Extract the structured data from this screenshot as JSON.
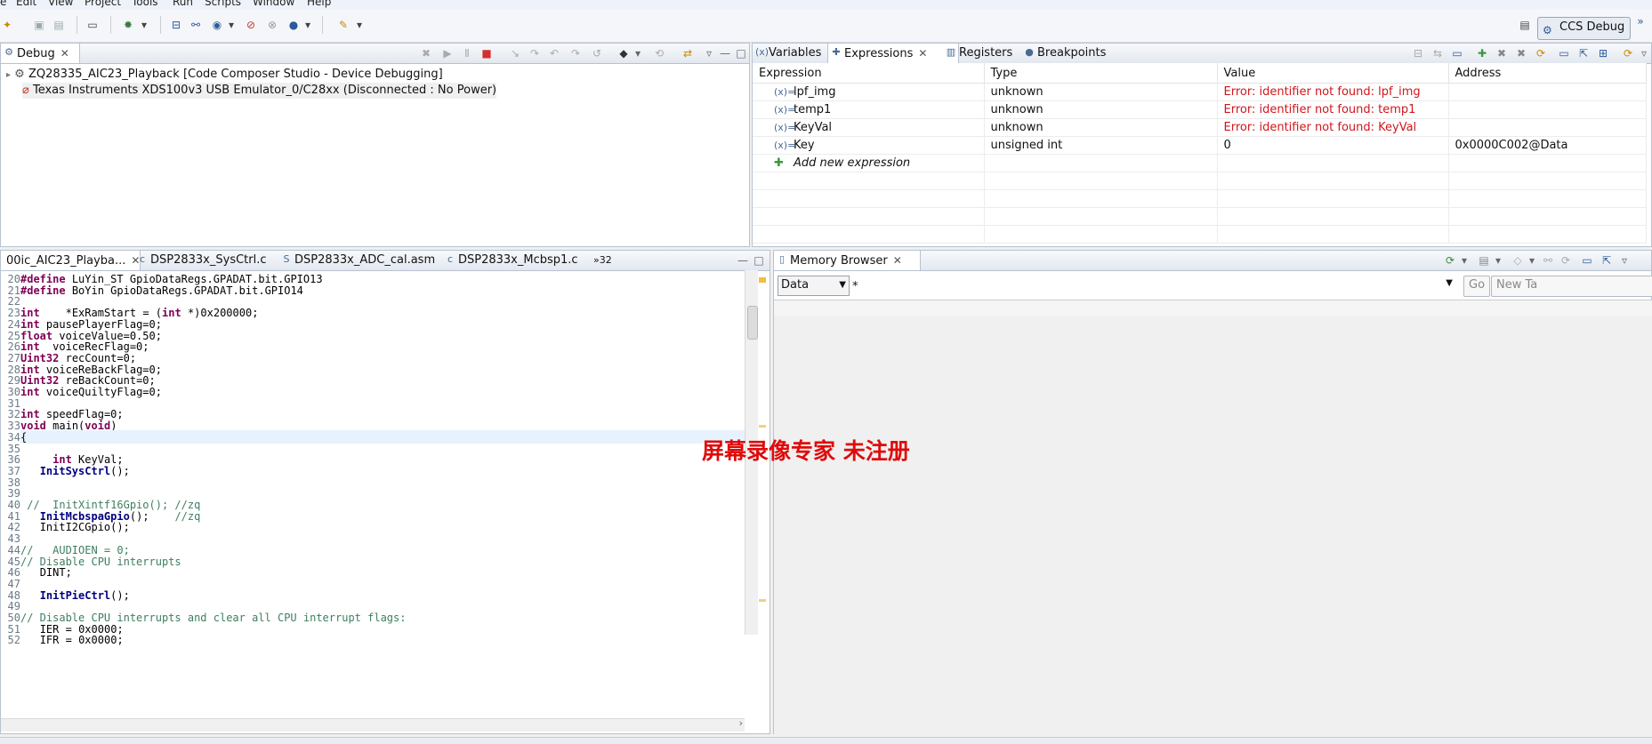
{
  "menu": [
    "e",
    "Edit",
    "View",
    "Project",
    "Tools",
    "Run",
    "Scripts",
    "Window",
    "Help"
  ],
  "perspective": {
    "label": "CCS Debug"
  },
  "debug_view": {
    "tab": "Debug",
    "rows": [
      "ZQ28335_AIC23_Playback [Code Composer Studio - Device Debugging]",
      "Texas Instruments XDS100v3 USB Emulator_0/C28xx (Disconnected : No Power)"
    ]
  },
  "expressions_view": {
    "tabs": [
      "Variables",
      "Expressions",
      "Registers",
      "Breakpoints"
    ],
    "columns": [
      "Expression",
      "Type",
      "Value",
      "Address"
    ],
    "rows": [
      {
        "icon": "(x)=",
        "name": "lpf_img",
        "type": "unknown",
        "value": "Error: identifier not found: lpf_img",
        "address": ""
      },
      {
        "icon": "(x)=",
        "name": "temp1",
        "type": "unknown",
        "value": "Error: identifier not found: temp1",
        "address": ""
      },
      {
        "icon": "(x)=",
        "name": "KeyVal",
        "type": "unknown",
        "value": "Error: identifier not found: KeyVal",
        "address": ""
      },
      {
        "icon": "(x)=",
        "name": "Key",
        "type": "unsigned int",
        "value": "0",
        "address": "0x0000C002@Data"
      }
    ],
    "add_new": "Add new expression"
  },
  "editor": {
    "tabs": [
      "00ic_AIC23_Playba...",
      "DSP2833x_SysCtrl.c",
      "DSP2833x_ADC_cal.asm",
      "DSP2833x_Mcbsp1.c",
      "32"
    ],
    "lines": [
      {
        "n": "20",
        "t": "#define LuYin_ST GpioDataRegs.GPADAT.bit.GPIO13"
      },
      {
        "n": "21",
        "t": "#define BoYin GpioDataRegs.GPADAT.bit.GPIO14"
      },
      {
        "n": "22",
        "t": ""
      },
      {
        "n": "23",
        "t": "int    *ExRamStart = (int *)0x200000;"
      },
      {
        "n": "24",
        "t": "int pausePlayerFlag=0;"
      },
      {
        "n": "25",
        "t": "float voiceValue=0.50;"
      },
      {
        "n": "26",
        "t": "int  voiceRecFlag=0;"
      },
      {
        "n": "27",
        "t": "Uint32 recCount=0;"
      },
      {
        "n": "28",
        "t": "int voiceReBackFlag=0;"
      },
      {
        "n": "29",
        "t": "Uint32 reBackCount=0;"
      },
      {
        "n": "30",
        "t": "int voiceQuiltyFlag=0;"
      },
      {
        "n": "31",
        "t": ""
      },
      {
        "n": "32",
        "t": "int speedFlag=0;"
      },
      {
        "n": "33",
        "t": "void main(void)"
      },
      {
        "n": "34",
        "t": "{"
      },
      {
        "n": "35",
        "t": ""
      },
      {
        "n": "36",
        "t": "     int KeyVal;"
      },
      {
        "n": "37",
        "t": "   InitSysCtrl();"
      },
      {
        "n": "38",
        "t": ""
      },
      {
        "n": "39",
        "t": ""
      },
      {
        "n": "40",
        "t": " //  InitXintf16Gpio(); //zq"
      },
      {
        "n": "41",
        "t": "   InitMcbspaGpio();    //zq"
      },
      {
        "n": "42",
        "t": "   InitI2CGpio();"
      },
      {
        "n": "43",
        "t": ""
      },
      {
        "n": "44",
        "t": "//   AUDIOEN = 0;"
      },
      {
        "n": "45",
        "t": "// Disable CPU interrupts"
      },
      {
        "n": "46",
        "t": "   DINT;"
      },
      {
        "n": "47",
        "t": ""
      },
      {
        "n": "48",
        "t": "   InitPieCtrl();"
      },
      {
        "n": "49",
        "t": ""
      },
      {
        "n": "50",
        "t": "// Disable CPU interrupts and clear all CPU interrupt flags:"
      },
      {
        "n": "51",
        "t": "   IER = 0x0000;"
      },
      {
        "n": "52",
        "t": "   IFR = 0x0000;"
      }
    ]
  },
  "memory_view": {
    "tab": "Memory Browser",
    "space": "Data",
    "address_prefix": "*",
    "go": "Go",
    "new_tab": "New Ta"
  },
  "watermark": "屏幕录像专家  未注册"
}
